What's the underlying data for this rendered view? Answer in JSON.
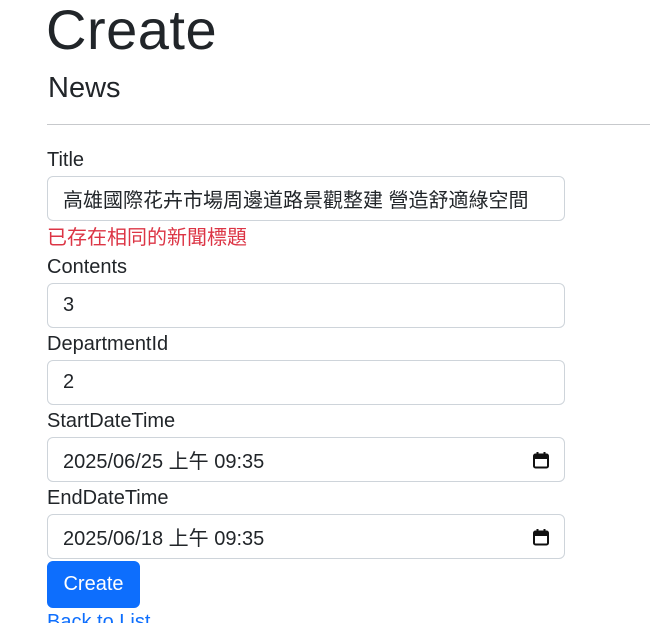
{
  "page": {
    "heading": "Create",
    "subheading": "News"
  },
  "form": {
    "title": {
      "label": "Title",
      "value": "高雄國際花卉市場周邊道路景觀整建 營造舒適綠空間",
      "error": "已存在相同的新聞標題"
    },
    "contents": {
      "label": "Contents",
      "value": "3"
    },
    "department_id": {
      "label": "DepartmentId",
      "value": "2"
    },
    "start_date_time": {
      "label": "StartDateTime",
      "value": "2025/06/25 上午 09:35",
      "icon": "calendar-icon"
    },
    "end_date_time": {
      "label": "EndDateTime",
      "value": "2025/06/18 上午 09:35",
      "icon": "calendar-icon"
    },
    "submit_label": "Create"
  },
  "back_link": "Back to List",
  "colors": {
    "primary": "#0d6efd",
    "danger": "#dc3545",
    "text": "#212529",
    "border": "#ced4da"
  }
}
